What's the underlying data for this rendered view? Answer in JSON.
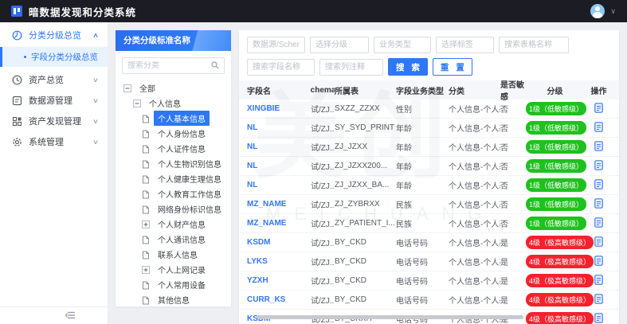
{
  "app": {
    "title": "暗数据发现和分类系统"
  },
  "colors": {
    "accent_blue": "#2e77f6",
    "badge_green": "#1fc11f",
    "badge_red": "#f5222d",
    "topbar_bg": "#1c1d24"
  },
  "sidebar": {
    "items": [
      {
        "label": "分类分级总览",
        "icon": "pie-clock-icon",
        "active": true,
        "caret": "up",
        "children": [
          {
            "label": "字段分类分级总览",
            "active": true
          }
        ]
      },
      {
        "label": "资产总览",
        "icon": "clock-icon",
        "active": false,
        "caret": "down",
        "children": []
      },
      {
        "label": "数据源管理",
        "icon": "datasource-icon",
        "active": false,
        "caret": "down",
        "children": []
      },
      {
        "label": "资产发现管理",
        "icon": "discovery-icon",
        "active": false,
        "caret": "down",
        "children": []
      },
      {
        "label": "系统管理",
        "icon": "gear-icon",
        "active": false,
        "caret": "down",
        "children": []
      }
    ]
  },
  "tree_panel": {
    "header": "分类分级标准名称",
    "search_placeholder": "搜索分类",
    "items": [
      {
        "label": "全部",
        "level": 0,
        "icon": "minus",
        "selected": false
      },
      {
        "label": "个人信息",
        "level": 1,
        "icon": "minus",
        "selected": false
      },
      {
        "label": "个人基本信息",
        "level": 2,
        "icon": "file",
        "selected": true
      },
      {
        "label": "个人身份信息",
        "level": 2,
        "icon": "file",
        "selected": false
      },
      {
        "label": "个人证件信息",
        "level": 2,
        "icon": "file",
        "selected": false
      },
      {
        "label": "个人生物识别信息",
        "level": 2,
        "icon": "file",
        "selected": false
      },
      {
        "label": "个人健康生理信息",
        "level": 2,
        "icon": "file",
        "selected": false
      },
      {
        "label": "个人教育工作信息",
        "level": 2,
        "icon": "file",
        "selected": false
      },
      {
        "label": "网络身份标识信息",
        "level": 2,
        "icon": "file",
        "selected": false
      },
      {
        "label": "个人财产信息",
        "level": 2,
        "icon": "plus",
        "selected": false
      },
      {
        "label": "个人通讯信息",
        "level": 2,
        "icon": "file",
        "selected": false
      },
      {
        "label": "联系人信息",
        "level": 2,
        "icon": "file",
        "selected": false
      },
      {
        "label": "个人上网记录",
        "level": 2,
        "icon": "plus",
        "selected": false
      },
      {
        "label": "个人常用设备",
        "level": 2,
        "icon": "file",
        "selected": false
      },
      {
        "label": "其他信息",
        "level": 2,
        "icon": "file",
        "selected": false
      }
    ]
  },
  "filters": {
    "row1": [
      {
        "placeholder": "数据源/Schema",
        "name": "datasource-schema-select"
      },
      {
        "placeholder": "选择分级",
        "name": "level-select"
      },
      {
        "placeholder": "业务类型",
        "name": "business-type-select"
      },
      {
        "placeholder": "选择标签",
        "name": "tag-select"
      },
      {
        "placeholder": "搜索表格名称",
        "name": "table-name-search-input"
      }
    ],
    "row2": [
      {
        "placeholder": "搜索字段名称",
        "name": "field-name-search-input"
      },
      {
        "placeholder": "搜索列注释",
        "name": "column-comment-search-input"
      }
    ],
    "search_label": "搜 索",
    "reset_label": "重 置"
  },
  "table": {
    "columns": [
      "字段名",
      "Schema",
      "所属表",
      "字段业务类型",
      "分类",
      "是否敏感",
      "分级",
      "操作"
    ],
    "rows": [
      {
        "field": "XINGBIE",
        "schema": "试/ZJ...",
        "table": "SXZZ_ZZXX",
        "biz_type": "性别",
        "category": "个人信息-个人基本...",
        "sensitive": "否",
        "level": "1级（低敏感级）",
        "level_color": "green"
      },
      {
        "field": "NL",
        "schema": "试/ZJ...",
        "table": "SY_SYD_PRINT",
        "biz_type": "年龄",
        "category": "个人信息-个人基本...",
        "sensitive": "否",
        "level": "1级（低敏感级）",
        "level_color": "green"
      },
      {
        "field": "NL",
        "schema": "试/ZJ...",
        "table": "ZJ_JZXX",
        "biz_type": "年龄",
        "category": "个人信息-个人基本...",
        "sensitive": "否",
        "level": "1级（低敏感级）",
        "level_color": "green"
      },
      {
        "field": "NL",
        "schema": "试/ZJ...",
        "table": "ZJ_JZXX200...",
        "biz_type": "年龄",
        "category": "个人信息-个人基本...",
        "sensitive": "否",
        "level": "1级（低敏感级）",
        "level_color": "green"
      },
      {
        "field": "NL",
        "schema": "试/ZJ...",
        "table": "ZJ_JZXX_BA...",
        "biz_type": "年龄",
        "category": "个人信息-个人基本...",
        "sensitive": "否",
        "level": "1级（低敏感级）",
        "level_color": "green"
      },
      {
        "field": "MZ_NAME",
        "schema": "试/ZJ...",
        "table": "ZJ_ZYBRXX",
        "biz_type": "民族",
        "category": "个人信息-个人基本...",
        "sensitive": "否",
        "level": "1级（低敏感级）",
        "level_color": "green"
      },
      {
        "field": "MZ_NAME",
        "schema": "试/ZJ...",
        "table": "ZY_PATIENT_I...",
        "biz_type": "民族",
        "category": "个人信息-个人基本...",
        "sensitive": "否",
        "level": "1级（低敏感级）",
        "level_color": "green"
      },
      {
        "field": "KSDM",
        "schema": "试/ZJ...",
        "table": "BY_CKD",
        "biz_type": "电话号码",
        "category": "个人信息-个人基本...",
        "sensitive": "是",
        "level": "4级（极高敏感级）",
        "level_color": "red"
      },
      {
        "field": "LYKS",
        "schema": "试/ZJ...",
        "table": "BY_CKD",
        "biz_type": "电话号码",
        "category": "个人信息-个人基本...",
        "sensitive": "是",
        "level": "4级（极高敏感级）",
        "level_color": "red"
      },
      {
        "field": "YZXH",
        "schema": "试/ZJ...",
        "table": "BY_CKD",
        "biz_type": "电话号码",
        "category": "个人信息-个人基本...",
        "sensitive": "是",
        "level": "4级（极高敏感级）",
        "level_color": "red"
      },
      {
        "field": "CURR_KS",
        "schema": "试/ZJ...",
        "table": "BY_CKD",
        "biz_type": "电话号码",
        "category": "个人信息-个人基本...",
        "sensitive": "是",
        "level": "4级（极高敏感级）",
        "level_color": "red"
      },
      {
        "field": "KSDM",
        "schema": "试/ZJ...",
        "table": "BY_CKXH",
        "biz_type": "电话号码",
        "category": "个人信息-个人基本...",
        "sensitive": "是",
        "level": "4级（极高敏感级）",
        "level_color": "red"
      }
    ]
  },
  "watermark": {
    "big": "美创",
    "sub": "MEICHUANG"
  }
}
